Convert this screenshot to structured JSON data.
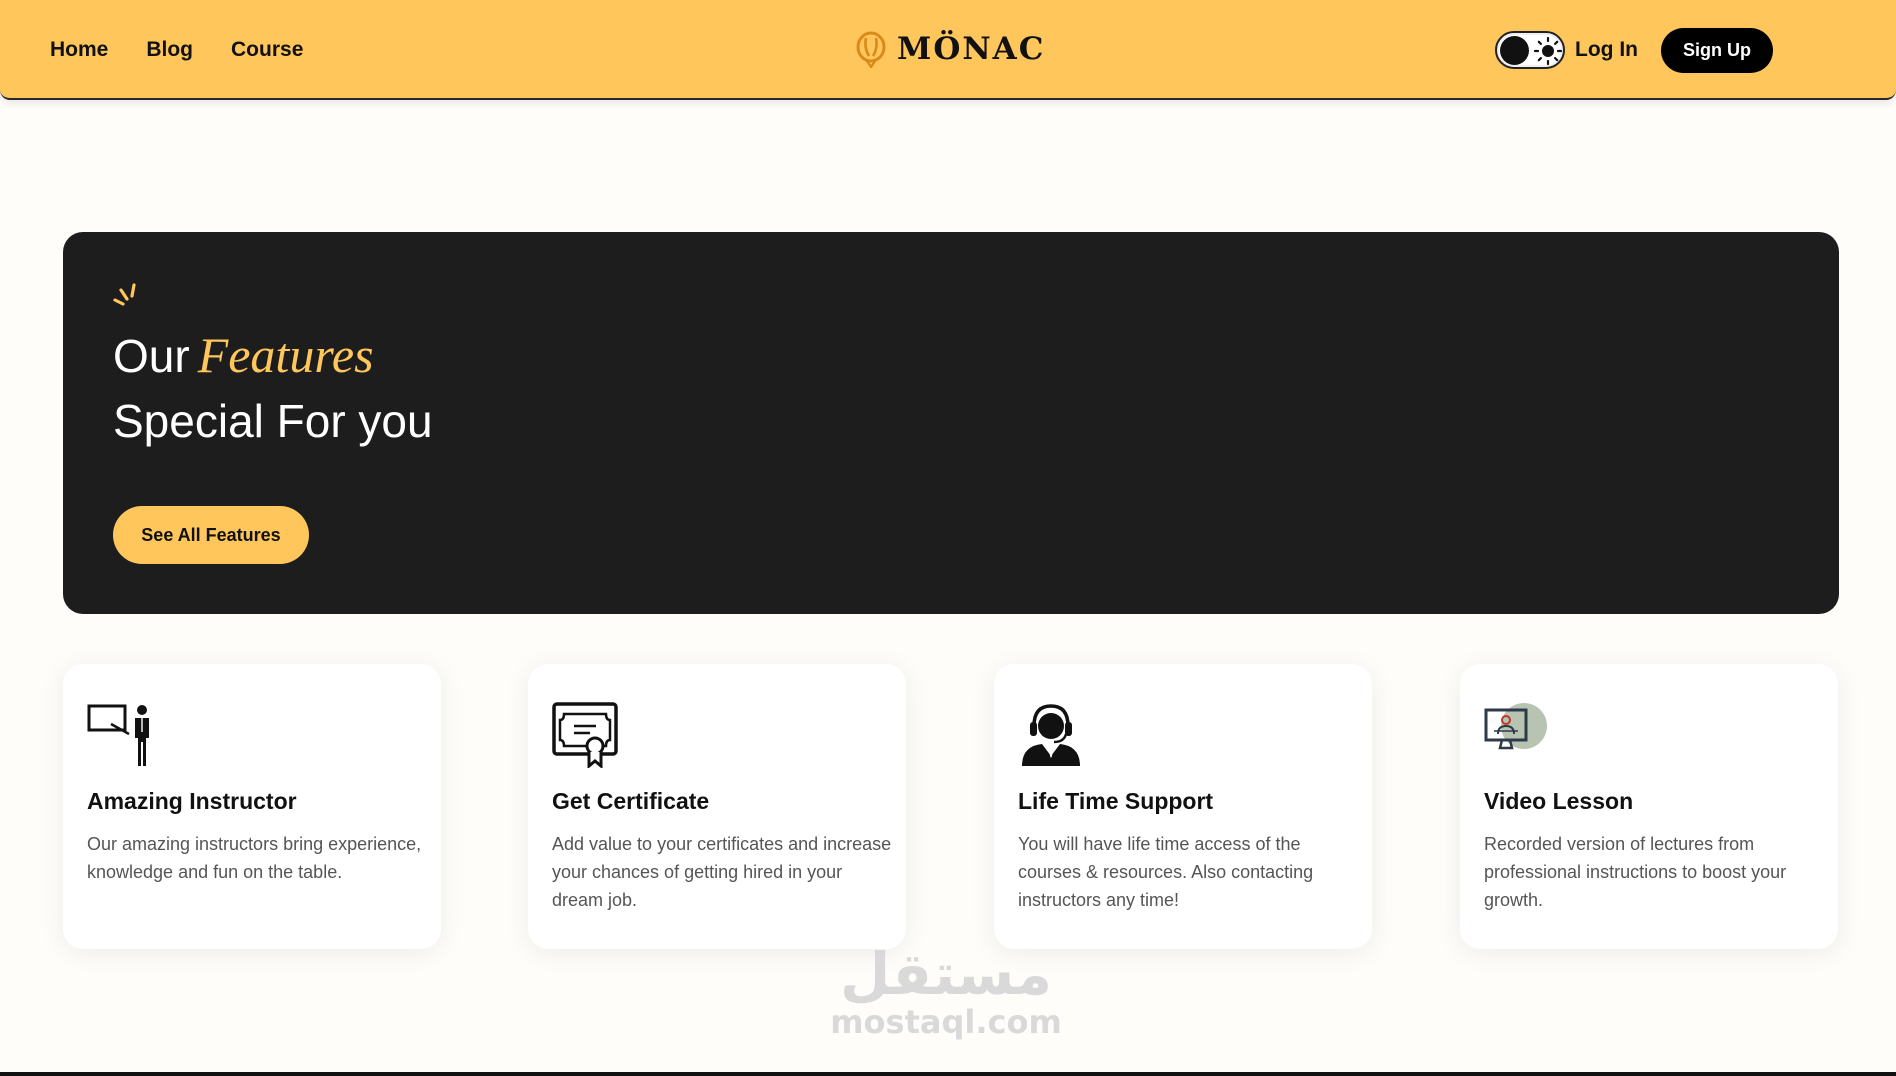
{
  "header": {
    "nav": [
      "Home",
      "Blog",
      "Course"
    ],
    "brand": "MÖNAC",
    "login_label": "Log In",
    "signup_label": "Sign Up",
    "theme_toggle": "light-mode"
  },
  "hero": {
    "title_prefix": "Our",
    "title_accent": "Features",
    "subtitle": "Special For you",
    "cta_label": "See All Features"
  },
  "features": [
    {
      "icon": "instructor-icon",
      "title": "Amazing Instructor",
      "description": "Our amazing instructors bring experience, knowledge and fun on the table."
    },
    {
      "icon": "certificate-icon",
      "title": "Get Certificate",
      "description": "Add value to your certificates and increase your chances of getting hired in your dream job."
    },
    {
      "icon": "support-agent-icon",
      "title": "Life Time Support",
      "description": "You will have life time access of the courses & resources. Also contacting instructors any time!"
    },
    {
      "icon": "video-lesson-icon",
      "title": "Video Lesson",
      "description": "Recorded version of lectures from professional instructions to boost your growth."
    }
  ],
  "watermark": {
    "arabic": "مستقل",
    "latin": "mostaql.com"
  },
  "colors": {
    "accent": "#ffc65c",
    "dark": "#1d1d1d",
    "text": "#111111",
    "muted": "#555555"
  }
}
